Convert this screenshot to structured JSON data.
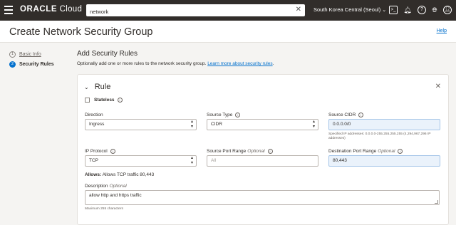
{
  "topbar": {
    "brand_bold": "ORACLE",
    "brand_light": " Cloud",
    "search_value": "network",
    "region": "South Korea Central (Seoul)"
  },
  "header": {
    "title": "Create Network Security Group",
    "help": "Help"
  },
  "steps": [
    {
      "num": "1",
      "label": "Basic Info"
    },
    {
      "num": "2",
      "label": "Security Rules"
    }
  ],
  "section": {
    "title": "Add Security Rules",
    "desc": "Optionally add one or more rules to the network security group. ",
    "link": "Learn more about security rules",
    "desc_end": "."
  },
  "rule": {
    "title": "Rule",
    "stateless_label": "Stateless",
    "direction_label": "Direction",
    "direction_value": "Ingress",
    "source_type_label": "Source Type",
    "source_type_value": "CIDR",
    "source_cidr_label": "Source CIDR",
    "source_cidr_value": "0.0.0.0/0",
    "source_cidr_help": "Specified IP addresses: 0.0.0.0-255.255.255.255 (4,294,967,296 IP addresses)",
    "ip_protocol_label": "IP Protocol",
    "ip_protocol_value": "TCP",
    "source_port_label": "Source Port Range",
    "source_port_optional": "Optional",
    "source_port_placeholder": "All",
    "dest_port_label": "Destination Port Range",
    "dest_port_optional": "Optional",
    "dest_port_value": "80,443",
    "allows_label": "Allows:",
    "allows_text": " Allows TCP traffic 80,443",
    "description_label": "Description",
    "description_optional": "Optional",
    "description_value": "allow http and https traffic",
    "description_help": "Maximum 255 characters"
  }
}
